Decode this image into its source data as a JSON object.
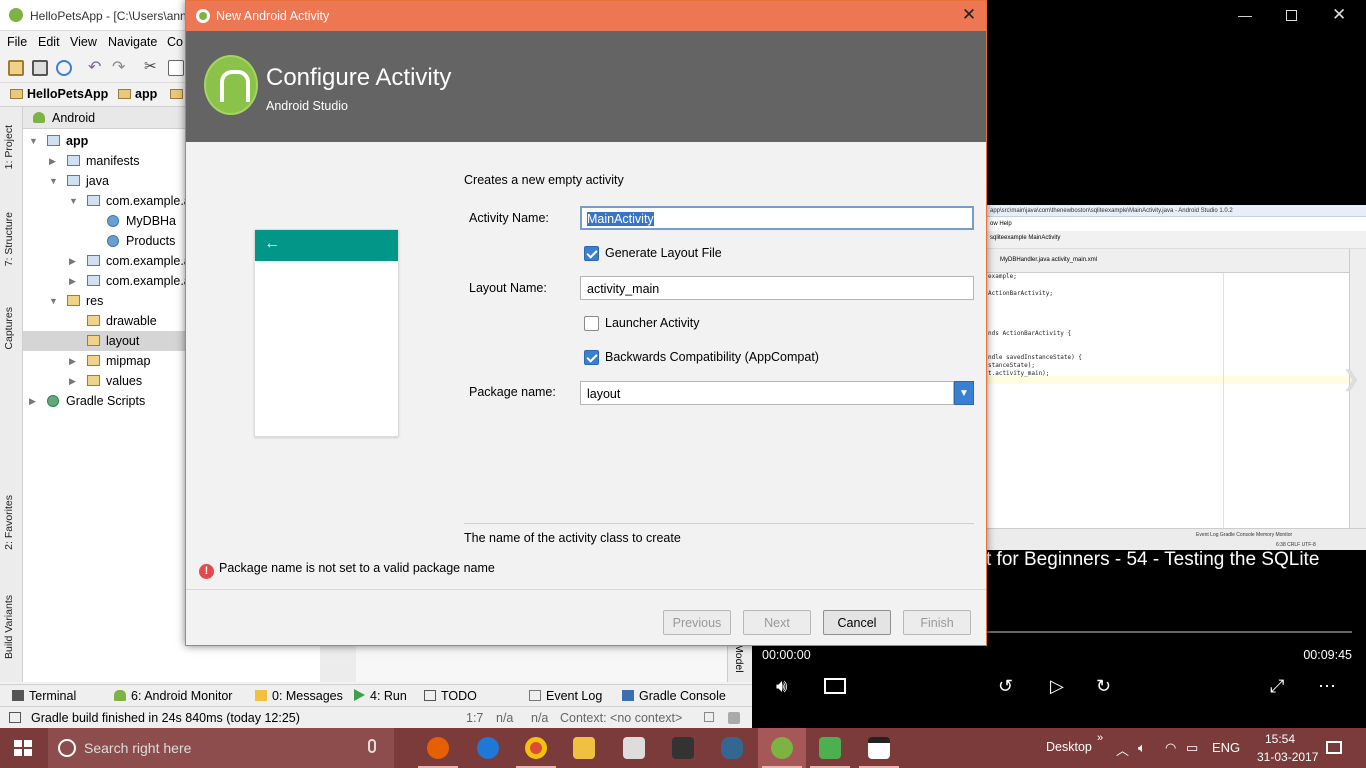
{
  "ide": {
    "title": "HelloPetsApp - [C:\\Users\\ann",
    "menu": [
      "File",
      "Edit",
      "View",
      "Navigate",
      "Co"
    ],
    "breadcrumb": [
      "HelloPetsApp",
      "app"
    ],
    "project_view": "Android",
    "side_tabs": [
      "1: Project",
      "7: Structure",
      "Captures",
      "2: Favorites",
      "Build Variants"
    ],
    "tree": [
      {
        "label": "app",
        "depth": 0,
        "arrow": "down",
        "icon": "app-folder"
      },
      {
        "label": "manifests",
        "depth": 1,
        "arrow": "right",
        "icon": "folder"
      },
      {
        "label": "java",
        "depth": 1,
        "arrow": "down",
        "icon": "folder"
      },
      {
        "label": "com.example.a",
        "depth": 2,
        "arrow": "down",
        "icon": "folder"
      },
      {
        "label": "MyDBHa",
        "depth": 3,
        "arrow": "",
        "icon": "class"
      },
      {
        "label": "Products",
        "depth": 3,
        "arrow": "",
        "icon": "class"
      },
      {
        "label": "com.example.a",
        "depth": 2,
        "arrow": "right",
        "icon": "folder"
      },
      {
        "label": "com.example.a",
        "depth": 2,
        "arrow": "right",
        "icon": "folder"
      },
      {
        "label": "res",
        "depth": 1,
        "arrow": "down",
        "icon": "res"
      },
      {
        "label": "drawable",
        "depth": 2,
        "arrow": "",
        "icon": "res"
      },
      {
        "label": "layout",
        "depth": 2,
        "arrow": "",
        "icon": "res",
        "selected": true
      },
      {
        "label": "mipmap",
        "depth": 2,
        "arrow": "right",
        "icon": "res"
      },
      {
        "label": "values",
        "depth": 2,
        "arrow": "right",
        "icon": "res"
      },
      {
        "label": "Gradle Scripts",
        "depth": 0,
        "arrow": "right",
        "icon": "gradle"
      }
    ],
    "right_strip_label": "Model",
    "bottom_tabs": [
      "Terminal",
      "6: Android Monitor",
      "0: Messages",
      "4: Run",
      "TODO",
      "Event Log",
      "Gradle Console"
    ],
    "status_message": "Gradle build finished in 24s 840ms (today 12:25)",
    "status_pos": "1:7",
    "status_na1": "n/a",
    "status_na2": "n/a",
    "status_context": "Context: <no context>"
  },
  "dialog": {
    "window_title": "New Android Activity",
    "close_glyph": "✕",
    "heading": "Configure Activity",
    "subheading": "Android Studio",
    "description": "Creates a new empty activity",
    "activity_name_label": "Activity Name:",
    "activity_name_value": "MainActivity",
    "generate_layout_label": "Generate Layout File",
    "generate_layout_checked": true,
    "layout_name_label": "Layout Name:",
    "layout_name_value": "activity_main",
    "launcher_activity_label": "Launcher Activity",
    "launcher_activity_checked": false,
    "backwards_compat_label": "Backwards Compatibility (AppCompat)",
    "backwards_compat_checked": true,
    "package_name_label": "Package name:",
    "package_name_value": "layout",
    "hint": "The name of the activity class to create",
    "error": "Package name is not set to a valid package name",
    "buttons": {
      "previous": "Previous",
      "next": "Next",
      "cancel": "Cancel",
      "finish": "Finish"
    }
  },
  "video": {
    "caption": "t for Beginners - 54 - Testing the SQLite",
    "time_current": "00:00:00",
    "time_total": "00:09:45",
    "frame_title": "app\\src\\main\\java\\com\\thenewboston\\sqliteexample\\MainActivity.java - Android Studio 1.0.2",
    "frame_menu": "ow  Help",
    "frame_crumbs": "sqliteexample  MainActivity",
    "frame_tabs": "MyDBHandler.java   activity_main.xml",
    "frame_code": [
      "example;",
      "ActionBarActivity;",
      "nds ActionBarActivity {",
      "ndle savedInstanceState) {",
      "stanceState);",
      "t.activity_main);"
    ],
    "frame_bottom": "Event Log   Gradle Console   Memory Monitor",
    "frame_status": "6:38  CRLF  UTF-8"
  },
  "taskbar": {
    "search_placeholder": "Search right here",
    "desktop_label": "Desktop",
    "language": "ENG",
    "time": "15:54",
    "date": "31-03-2017"
  },
  "colors": {
    "dialog_title_bg": "#ed7653",
    "dialog_header_bg": "#646464",
    "phone_bar": "#009688",
    "taskbar_bg": "#7a3b3a"
  }
}
